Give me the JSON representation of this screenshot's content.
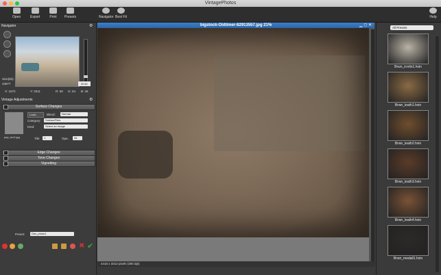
{
  "window": {
    "title": "VintagePhotos"
  },
  "toolbar": {
    "open": "Open",
    "export": "Export",
    "print": "Print",
    "presets": "Presets",
    "navigator": "Navigator",
    "best_fit": "Best Fit",
    "help": "Help"
  },
  "navigator": {
    "title": "Navigator",
    "zoom_value": "20.61",
    "size_label": "Size(kb):",
    "size_value": "43877",
    "x": "X: 1672",
    "y": "Y: 3311",
    "r": "R: 69",
    "g": "G: 54",
    "b": "B: 45"
  },
  "adjustments": {
    "title": "Vintage Adjustments",
    "surface_changes": "Surface Changes",
    "load_button": "Load...",
    "blend_label": "Blend:",
    "blend_value": "Normal",
    "category_label": "Category:",
    "category_value": "SurfaceFiles",
    "kind_label": "Kind:",
    "kind_value": "Select an Image",
    "texture_file": "pap_tex3.jpg",
    "tile_label": "Tile:",
    "tile_value": "1",
    "opacity_label": "Opa..",
    "opacity_value": "34",
    "edge_changes": "Edge Changes",
    "tone_changes": "Tone Changes",
    "vignetting": "Vignetting"
  },
  "preset_bar": {
    "label": "Preset:",
    "value": "Dkn_photo1"
  },
  "document": {
    "title": "bigstock-Oldtimer-82913557.jpg 21%",
    "status": "4416 x 3312 pixels (300 dpi)"
  },
  "presets_panel": {
    "filter": "All Presets",
    "items": [
      {
        "name": "Brwn_irrelin1.hvin",
        "tone": "#b9b3a6"
      },
      {
        "name": "Brwn_leath1.hvin",
        "tone": "#8a6a44"
      },
      {
        "name": "Brwn_leath2.hvin",
        "tone": "#6f4e2e"
      },
      {
        "name": "Brwn_leath3.hvin",
        "tone": "#5b3b28"
      },
      {
        "name": "Brwn_leath4.hvin",
        "tone": "#7a5236"
      },
      {
        "name": "Brwn_medall1.hvin",
        "tone": "#2c2a27"
      }
    ]
  },
  "colors": {
    "accent": "#2c66a8",
    "apply": "#3ca53c",
    "cancel": "#cc3333"
  }
}
